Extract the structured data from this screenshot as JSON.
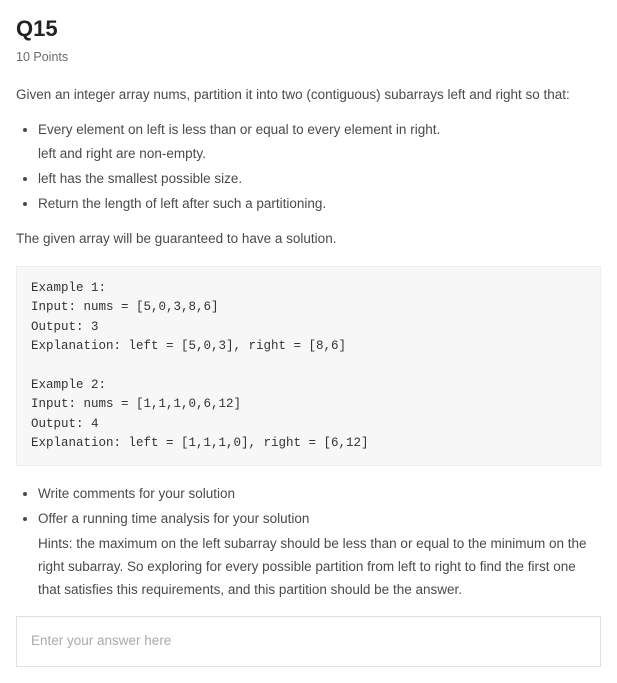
{
  "question": {
    "id": "Q15",
    "points_label": "10 Points",
    "prompt": "Given an integer array nums, partition it into two (contiguous) subarrays left and right so that:",
    "bullets": [
      {
        "text": "Every element on left is less than or equal to every element in right.",
        "sub": "left and right are non-empty."
      },
      {
        "text": "left has the smallest possible size."
      },
      {
        "text": "Return the length of left after such a partitioning."
      }
    ],
    "guarantee": "The given array will be guaranteed to have a solution.",
    "examples_text": "Example 1:\nInput: nums = [5,0,3,8,6]\nOutput: 3\nExplanation: left = [5,0,3], right = [8,6]\n\nExample 2:\nInput: nums = [1,1,1,0,6,12]\nOutput: 4\nExplanation: left = [1,1,1,0], right = [6,12]",
    "tasks": [
      {
        "text": "Write comments for your solution"
      },
      {
        "text": "Offer a running time analysis for your solution",
        "hints": "Hints: the maximum on the left subarray should be less than or equal to the minimum on the right subarray. So exploring for every possible partition from left to right to find the first one that satisfies this requirements, and this partition should be the answer."
      }
    ],
    "answer_placeholder": "Enter your answer here"
  }
}
